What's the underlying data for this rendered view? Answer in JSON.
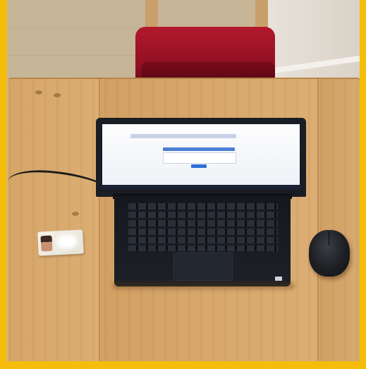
{
  "scene": {
    "objects": [
      "wooden-table",
      "red-chair",
      "laptop",
      "id-card",
      "mouse",
      "power-cable"
    ]
  },
  "colors": {
    "frame": "#f5bd0a",
    "table": "#dcae73",
    "chair": "#a3142a",
    "laptop": "#1a1d24",
    "screen": "#fdfdfe",
    "screen_accent": "#2f6fd8",
    "mouse": "#1d1f23"
  },
  "icons": [
    "laptop-icon",
    "mouse-icon",
    "id-card-icon"
  ]
}
